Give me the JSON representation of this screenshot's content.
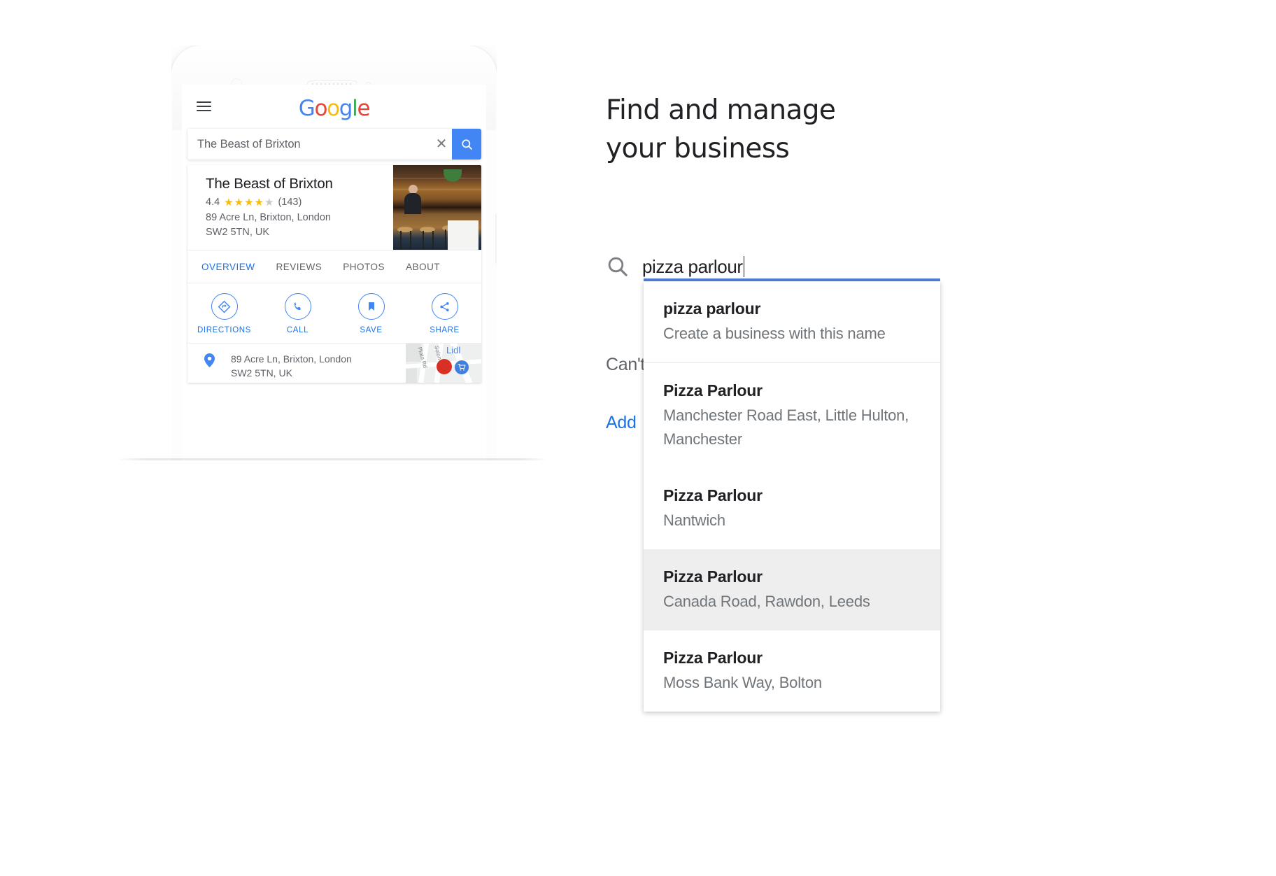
{
  "phone": {
    "google_logo_letters": [
      "G",
      "o",
      "o",
      "g",
      "l",
      "e"
    ],
    "menu_icon": "hamburger-menu-icon",
    "search": {
      "query": "The Beast of Brixton",
      "clear_icon": "clear-x-icon",
      "search_icon": "search-icon"
    },
    "knowledge_panel": {
      "title": "The Beast of Brixton",
      "rating_value": "4.4",
      "stars_filled": 4,
      "stars_total": 5,
      "review_count": "(143)",
      "address_line1": "89 Acre Ln, Brixton, London",
      "address_line2": "SW2 5TN, UK",
      "tabs": [
        {
          "label": "OVERVIEW",
          "active": true
        },
        {
          "label": "REVIEWS",
          "active": false
        },
        {
          "label": "PHOTOS",
          "active": false
        },
        {
          "label": "ABOUT",
          "active": false
        }
      ],
      "actions": [
        {
          "label": "DIRECTIONS",
          "icon": "directions-icon"
        },
        {
          "label": "CALL",
          "icon": "phone-icon"
        },
        {
          "label": "SAVE",
          "icon": "bookmark-icon"
        },
        {
          "label": "SHARE",
          "icon": "share-icon"
        }
      ],
      "address_row": {
        "pin_icon": "map-pin-icon",
        "line1": "89 Acre Ln, Brixton, London",
        "line2": "SW2 5TN, UK"
      },
      "map": {
        "labels": [
          "Plato Rd",
          "Solon"
        ],
        "poi_label": "Lidl",
        "markers": [
          "place-marker-red",
          "store-marker-blue"
        ]
      }
    }
  },
  "right": {
    "title": "Find and manage\nyour business",
    "search": {
      "icon": "search-icon",
      "value": "pizza parlour",
      "underline_color": "#4f7fd6"
    },
    "background_text": {
      "cant_find": "Can't",
      "add_link": "Add"
    },
    "suggestions": [
      {
        "name": "pizza parlour",
        "desc": "Create a business with this name",
        "highlight": false,
        "separator": false
      },
      {
        "name": "Pizza Parlour",
        "desc": "Manchester Road East, Little Hulton, Manchester",
        "highlight": false,
        "separator": true
      },
      {
        "name": "Pizza Parlour",
        "desc": "Nantwich",
        "highlight": false,
        "separator": false
      },
      {
        "name": "Pizza Parlour",
        "desc": "Canada Road, Rawdon, Leeds",
        "highlight": true,
        "separator": false
      },
      {
        "name": "Pizza Parlour",
        "desc": "Moss Bank Way, Bolton",
        "highlight": false,
        "separator": false
      }
    ]
  },
  "colors": {
    "google_blue": "#4285F4",
    "link_blue": "#1a73e8",
    "star_yellow": "#fabb05",
    "text_primary": "#202124",
    "text_secondary": "#5f6368",
    "underline": "#4f7fd6",
    "highlight_bg": "#eeeeee"
  }
}
